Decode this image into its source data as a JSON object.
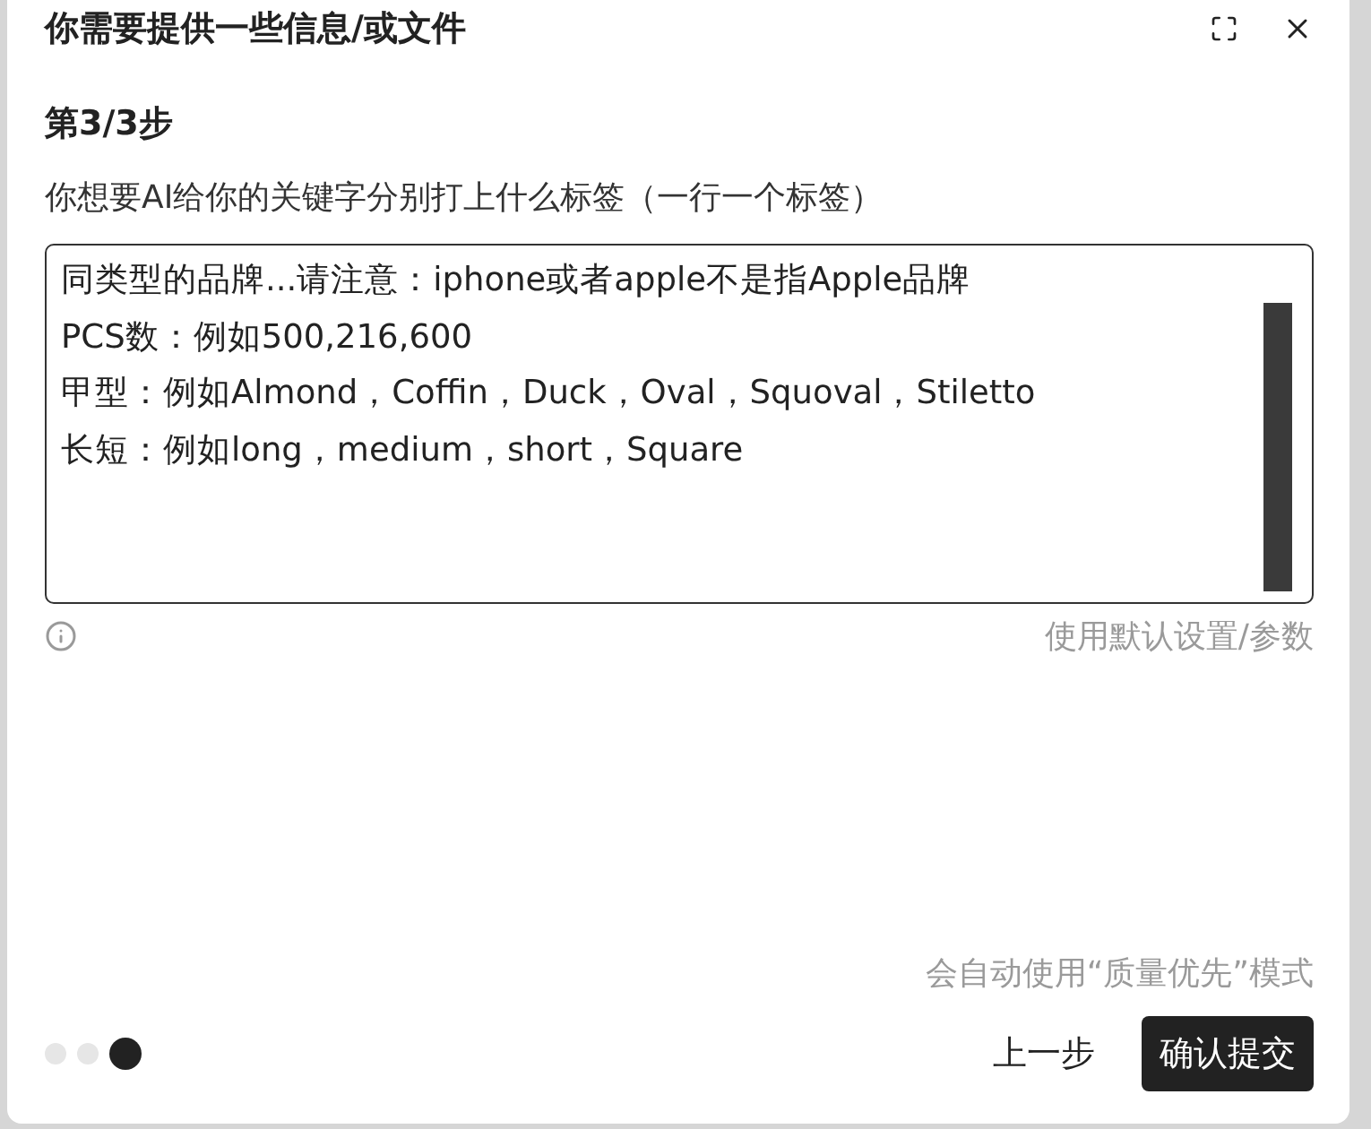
{
  "dialog": {
    "title": "你需要提供一些信息/或文件",
    "step": "第3/3步",
    "prompt": "你想要AI给你的关键字分别打上什么标签（一行一个标签）",
    "textarea": {
      "value": "同类型的品牌...请注意：iphone或者apple不是指Apple品牌\nPCS数：例如500,216,600\n甲型：例如Almond，Coffin，Duck，Oval，Squoval，Stiletto\n长短：例如long，medium，short，Square"
    },
    "default_link": "使用默认设置/参数",
    "note": "会自动使用“质量优先”模式",
    "steps": [
      {
        "selected": false
      },
      {
        "selected": false
      },
      {
        "selected": true
      }
    ],
    "buttons": [
      {
        "label": "上一步",
        "kind": "secondary"
      },
      {
        "label": "确认提交",
        "kind": "primary"
      }
    ]
  }
}
